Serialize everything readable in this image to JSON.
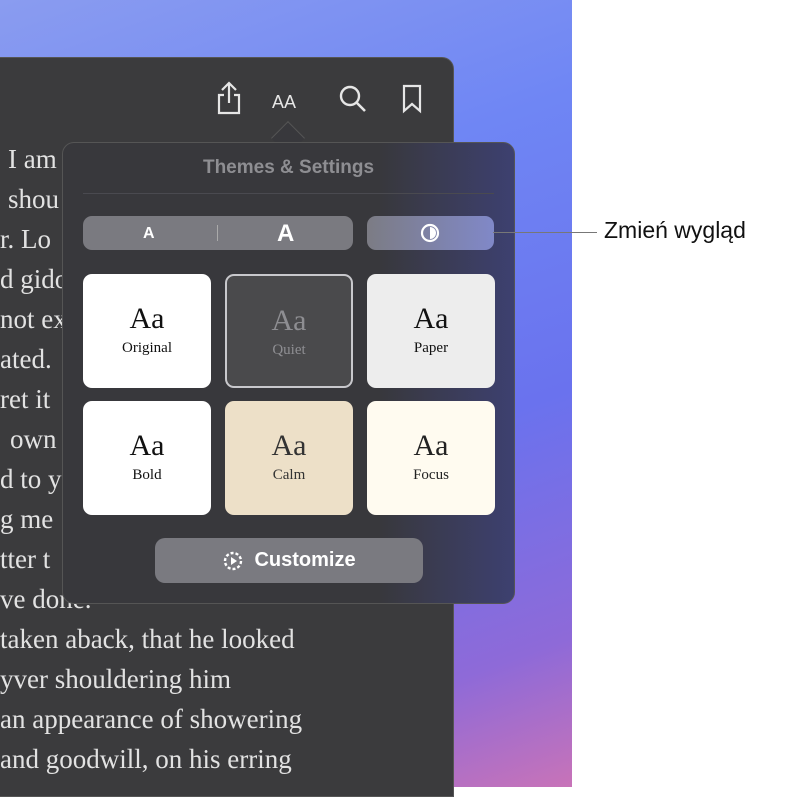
{
  "toolbar": {
    "icons": [
      "share-icon",
      "text-size-icon",
      "search-icon",
      "bookmark-icon"
    ],
    "aa_label": "AA"
  },
  "book_lines": [
    "I am",
    "shou",
    "r. Lo",
    "d gido",
    "not ex",
    "ated.",
    "ret it",
    "own",
    "d to y",
    "g me",
    "tter t",
    "ve done.",
    "taken aback, that he looked",
    "yver shouldering him",
    "an appearance of showering",
    "and goodwill, on his erring"
  ],
  "popover": {
    "title": "Themes & Settings",
    "font_small": "A",
    "font_large": "A",
    "appearance_icon": "appearance-icon",
    "themes": [
      {
        "name": "Original",
        "sample": "Aa",
        "bg": "#ffffff",
        "fg": "#111111"
      },
      {
        "name": "Quiet",
        "sample": "Aa",
        "bg": "#4a4a4c",
        "fg": "#8e8e92",
        "selected": true
      },
      {
        "name": "Paper",
        "sample": "Aa",
        "bg": "#ededed",
        "fg": "#111111"
      },
      {
        "name": "Bold",
        "sample": "Aa",
        "bg": "#ffffff",
        "fg": "#111111"
      },
      {
        "name": "Calm",
        "sample": "Aa",
        "bg": "#ede0c8",
        "fg": "#333333"
      },
      {
        "name": "Focus",
        "sample": "Aa",
        "bg": "#fffbf0",
        "fg": "#222222"
      }
    ],
    "customize": "Customize"
  },
  "callout": "Zmień wygląd"
}
